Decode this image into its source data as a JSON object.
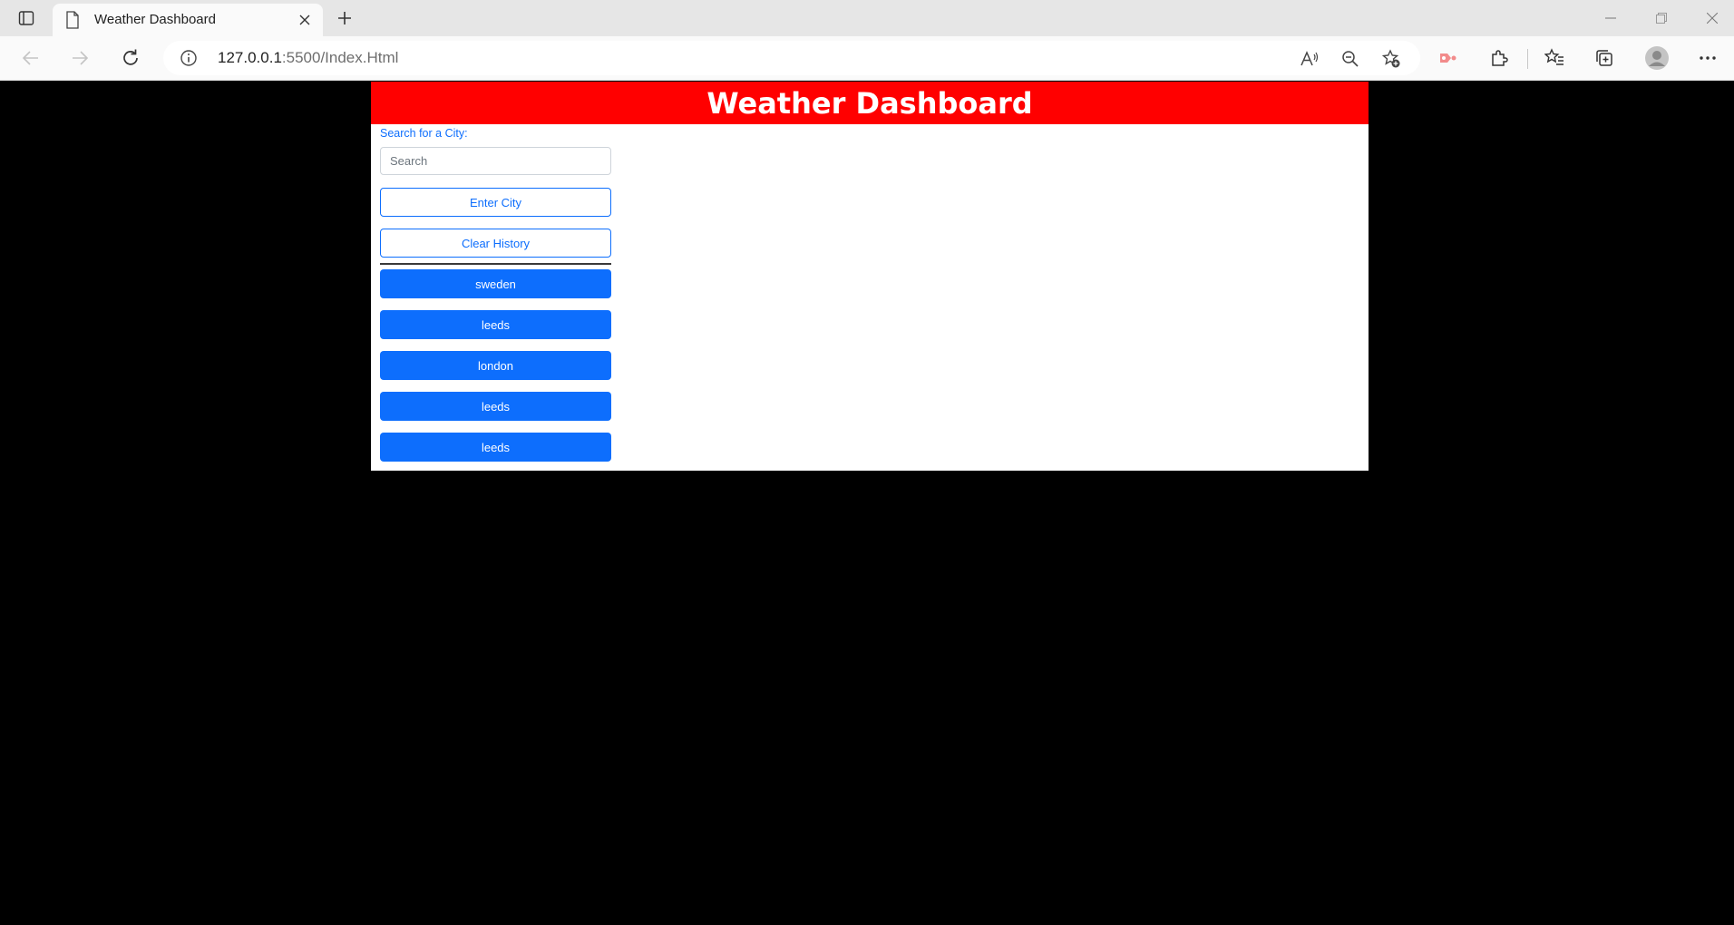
{
  "browser": {
    "tab_title": "Weather Dashboard",
    "url_host": "127.0.0.1",
    "url_rest": ":5500/Index.Html"
  },
  "page": {
    "header_title": "Weather Dashboard",
    "search_label": "Search for a City:",
    "search_placeholder": "Search",
    "enter_button": "Enter City",
    "clear_button": "Clear History",
    "history": [
      "sweden",
      "leeds",
      "london",
      "leeds",
      "leeds"
    ]
  },
  "colors": {
    "header_bg": "#ff0000",
    "primary": "#0d6efd",
    "page_bg": "#000000"
  }
}
